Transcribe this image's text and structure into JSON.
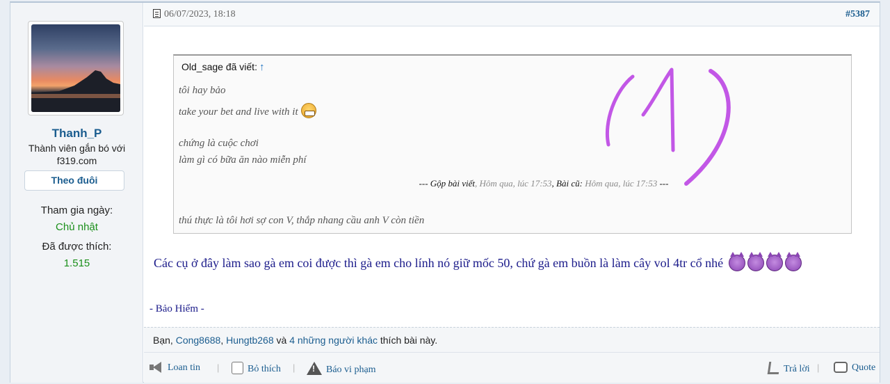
{
  "sidebar": {
    "username": "Thanh_P",
    "user_title": "Thành viên gắn bó với f319.com",
    "follow_label": "Theo đuôi",
    "joined_label": "Tham gia ngày:",
    "joined_value": "Chủ nhật",
    "likes_label": "Đã được thích:",
    "likes_value": "1.515"
  },
  "post": {
    "date": "06/07/2023, 18:18",
    "number": "#5387",
    "quote": {
      "author_line": "Old_sage đã viết:",
      "arrow": "↑",
      "lines": [
        "tôi hay bảo",
        "take your bet and live with it",
        "chứng là cuộc chơi",
        "làm gì có bữa ăn nào miễn phí",
        "thú thực là tôi hơi sợ con V, thắp nhang cầu anh V còn tiền"
      ],
      "merge": {
        "prefix": "--- ",
        "merged_label": "Gộp bài viết",
        "merged_time": ", Hôm qua, lúc 17:53",
        "old_label": ", Bài cũ:",
        "old_time": " Hôm qua, lúc 17:53",
        "suffix": " ---"
      }
    },
    "body": "Các cụ ở đây làm sao gà em coi được thì gà em cho lính nó giữ mốc 50, chứ gà em buồn là làm cây vol 4tr cổ nhé",
    "signature": "- Bảo Hiểm -",
    "handwritten_annotation": "(1)"
  },
  "likes": {
    "you": "Bạn",
    "sep1": ", ",
    "user1": "Cong8688",
    "sep2": ", ",
    "user2": "Hungtb268",
    "and": " và ",
    "others": "4 những người khác",
    "suffix": " thích bài này."
  },
  "actions": {
    "share": "Loan tin",
    "unlike": "Bỏ thích",
    "report": "Báo vi phạm",
    "reply": "Trả lời",
    "quote": "Quote",
    "separator": "|"
  },
  "colors": {
    "link": "#1b5d8f",
    "post_text": "#1b1b8a",
    "stat_value": "#1a8f1a",
    "annotation": "#c257e6"
  }
}
